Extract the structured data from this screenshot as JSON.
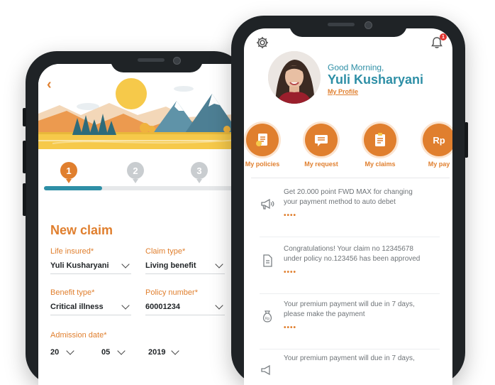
{
  "claim_screen": {
    "back_label": "‹",
    "steps": [
      "1",
      "2",
      "3"
    ],
    "progress_fraction": 0.29,
    "title": "New claim",
    "fields": {
      "life_insured": {
        "label": "Life insured*",
        "value": "Yuli Kusharyani"
      },
      "claim_type": {
        "label": "Claim type*",
        "value": "Living benefit"
      },
      "benefit_type": {
        "label": "Benefit type*",
        "value": "Critical illness"
      },
      "policy_number": {
        "label": "Policy number*",
        "value": "60001234"
      },
      "admission_date": {
        "label": "Admission date*",
        "day": "20",
        "month": "05",
        "year": "2019"
      }
    }
  },
  "home_screen": {
    "greeting": "Good Morning,",
    "user_name": "Yuli Kusharyani",
    "profile_link": "My Profile",
    "notification_badge": "1",
    "quick_actions": [
      {
        "label": "My policies",
        "icon": "policy-document-icon"
      },
      {
        "label": "My request",
        "icon": "request-message-icon"
      },
      {
        "label": "My claims",
        "icon": "claims-clipboard-icon"
      },
      {
        "label": "My pay",
        "icon": "payment-rp-icon",
        "icon_text": "Rp"
      }
    ],
    "notifications": [
      {
        "icon": "megaphone-icon",
        "text": "Get 20.000 point FWD MAX for changing your payment method to auto debet",
        "dots": "••••"
      },
      {
        "icon": "document-icon",
        "text": "Congratulations! Your claim no 12345678 under policy no.123456 has been approved",
        "dots": "••••"
      },
      {
        "icon": "money-bag-icon",
        "icon_text": "Rp",
        "text": "Your premium payment will due in 7 days, please make the payment",
        "dots": "••••"
      },
      {
        "icon": "megaphone-icon",
        "text": "Your premium payment will due in 7 days,"
      }
    ]
  },
  "colors": {
    "accent": "#e07f2e",
    "teal": "#2e8fa6",
    "frame": "#1f2326"
  }
}
